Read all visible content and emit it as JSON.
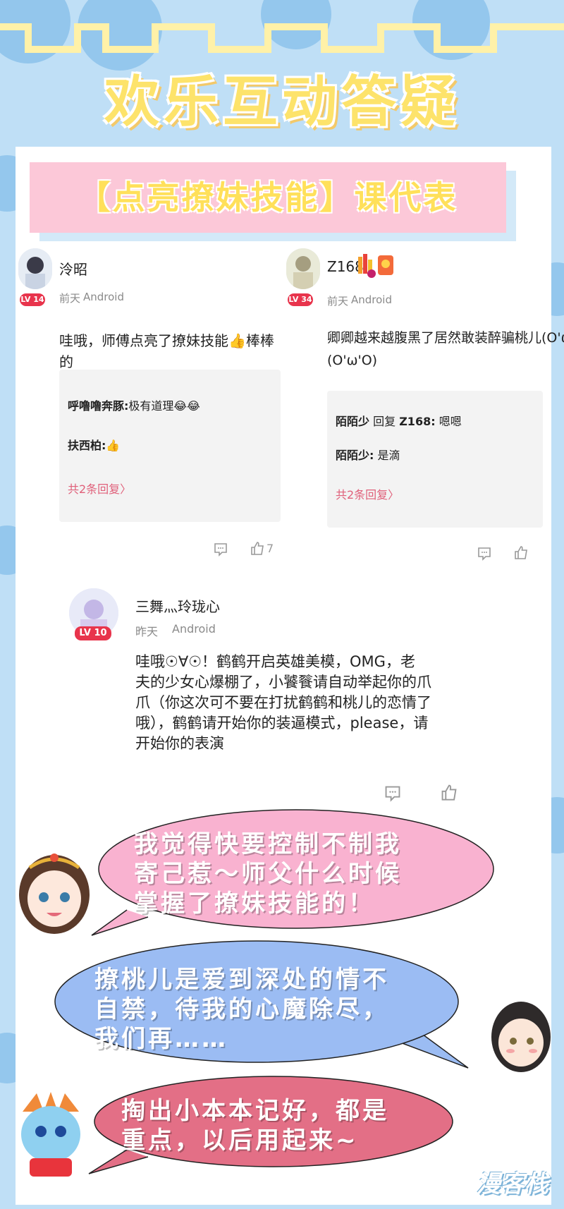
{
  "title": "欢乐互动答疑",
  "banner": "【点亮撩妹技能】课代表",
  "comments": [
    {
      "user": "泠昭",
      "level": "LV 14",
      "time": "前天",
      "device": "Android",
      "text": "哇哦，师傅点亮了撩妹技能👍棒棒的",
      "replies": [
        {
          "name": "呼噜噜奔豚:",
          "text": "极有道理😂😂"
        },
        {
          "name": "扶西柏:",
          "text": "👍"
        }
      ],
      "more": "共2条回复〉",
      "likes": "7"
    },
    {
      "user": "Z168",
      "level": "LV 34",
      "time": "前天",
      "device": "Android",
      "text_line1": "卿卿越来越腹黑了居然敢装醉骗桃儿(O'ω'O)",
      "text_line2": "(O'ω'O)",
      "replies": [
        {
          "name": "陌陌少",
          "mid": " 回复 ",
          "target": "Z168:",
          "text": " 嗯嗯"
        },
        {
          "name": "陌陌少:",
          "text": " 是滴"
        }
      ],
      "more": "共2条回复〉"
    },
    {
      "user": "三舞灬玲珑心",
      "level": "LV 10",
      "time": "昨天",
      "device": "Android",
      "lines": [
        "哇哦☉∀☉！鹤鹤开启英雄美模，OMG，老",
        "夫的少女心爆棚了，小饕餮请自动举起你的爪",
        "爪（你这次可不要在打扰鹤鹤和桃儿的恋情了",
        "哦），鹤鹤请开始你的装逼模式，please，请",
        "开始你的表演"
      ]
    }
  ],
  "bubbles": [
    {
      "lines": [
        "我觉得快要控制不制我",
        "寄己惹～师父什么时候",
        "掌握了撩妹技能的！"
      ],
      "color": "#f9b2d0"
    },
    {
      "lines": [
        "撩桃儿是爱到深处的情不",
        "自禁，待我的心魔除尽，",
        "我们再……"
      ],
      "color": "#9bbcf3"
    },
    {
      "lines": [
        "掏出小本本记好，都是",
        "重点，以后用起来~"
      ],
      "color": "#e36f86"
    }
  ],
  "watermark": "漫客栈"
}
